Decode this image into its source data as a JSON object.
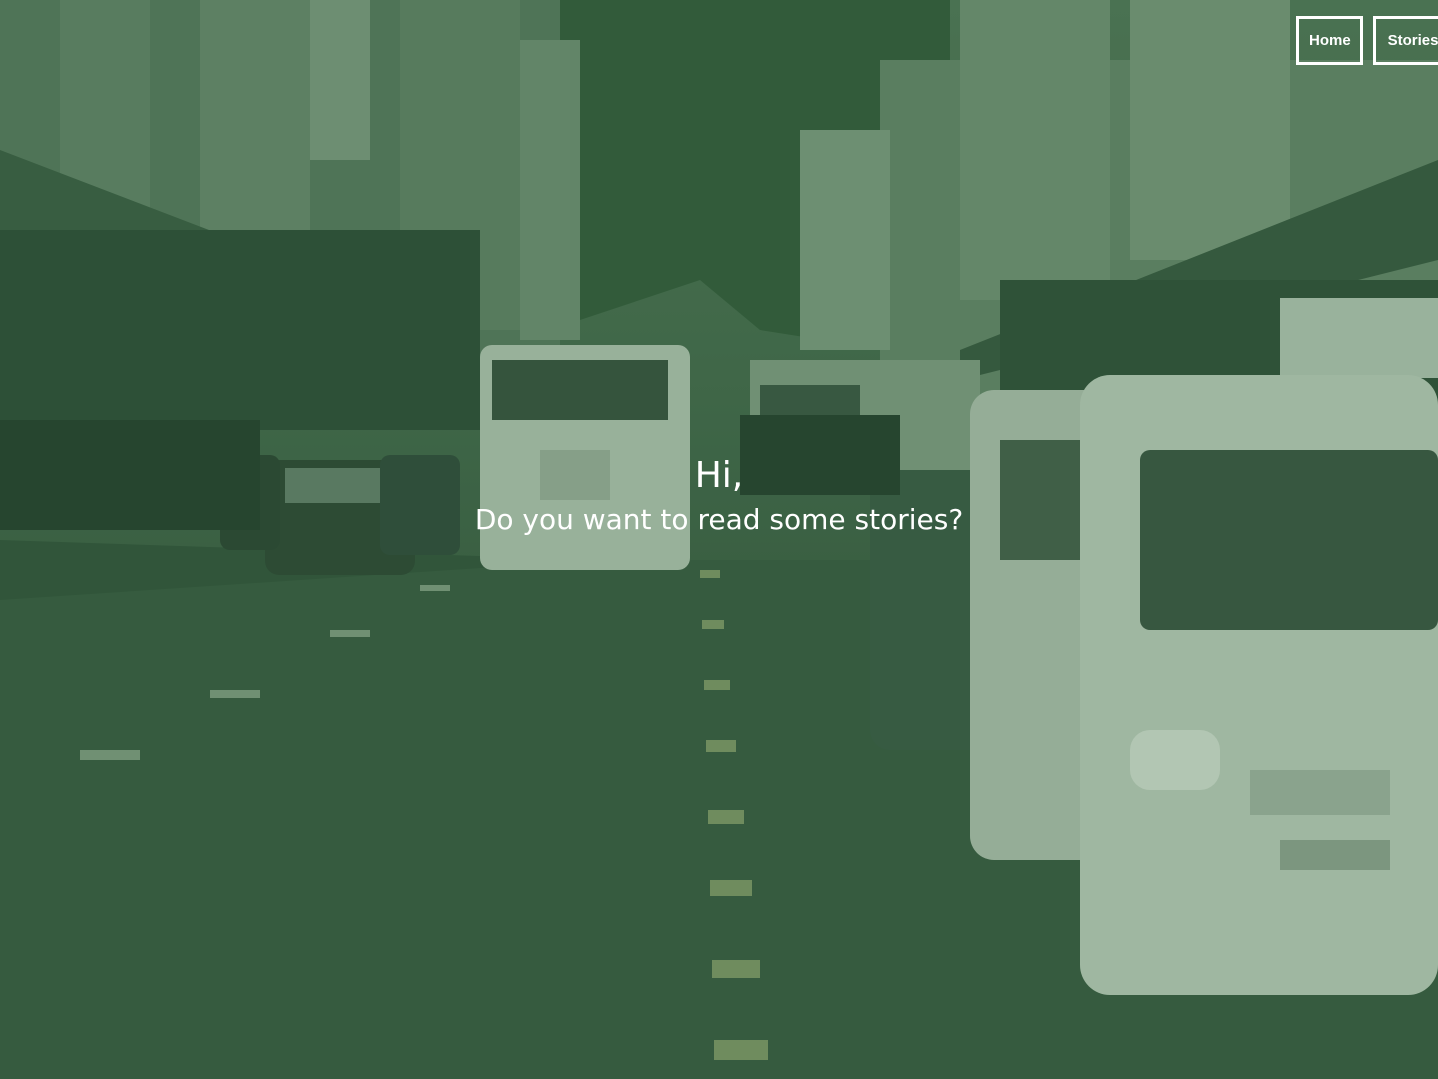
{
  "nav": {
    "home_label": "Home",
    "stories_label": "Stories"
  },
  "hero": {
    "heading": "Hi,",
    "subheading": "Do you want to read some stories?",
    "overlay_color": "#2a603a"
  }
}
